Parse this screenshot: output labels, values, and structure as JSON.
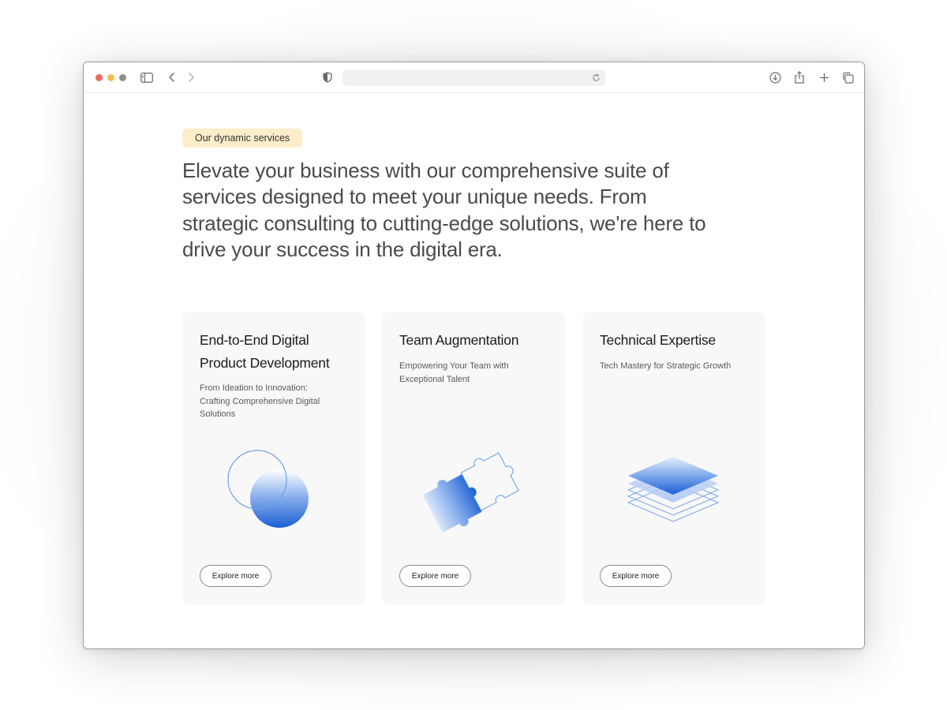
{
  "browser": {
    "address_value": "",
    "address_placeholder": ""
  },
  "section": {
    "badge": "Our dynamic services",
    "headline": "Elevate your business with our comprehensive suite of services designed to meet your unique needs. From strategic consulting to cutting-edge solutions, we're here to drive your success in the digital era."
  },
  "cards": [
    {
      "title": "End-to-End Digital Product Development",
      "description": "From Ideation to Innovation: Crafting Comprehensive Digital Solutions",
      "button": "Explore more",
      "illustration": "overlapping-circles-icon"
    },
    {
      "title": "Team Augmentation",
      "description": "Empowering Your Team with Exceptional Talent",
      "button": "Explore more",
      "illustration": "puzzle-pieces-icon"
    },
    {
      "title": "Technical Expertise",
      "description": "Tech Mastery for Strategic Growth",
      "button": "Explore more",
      "illustration": "stacked-layers-icon"
    }
  ],
  "colors": {
    "accent_blue": "#1a63d6",
    "badge_background": "#fdedc9",
    "card_background": "#f8f8f8"
  }
}
